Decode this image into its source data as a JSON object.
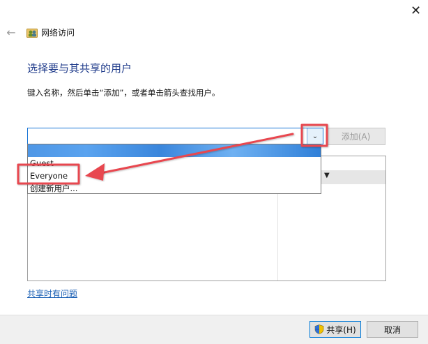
{
  "window": {
    "title": "网络访问",
    "close_glyph": "✕",
    "back_glyph": "←"
  },
  "heading": "选择要与其共享的用户",
  "instruction": "键入名称，然后单击“添加”，或者单击箭头查找用户。",
  "combo": {
    "value": "",
    "arrow_glyph": "⌄"
  },
  "add_button": "添加(A)",
  "dropdown": {
    "items": [
      "Guest",
      "Everyone",
      "创建新用户..."
    ]
  },
  "link": "共享时有问题",
  "footer": {
    "share": "共享(H)",
    "cancel": "取消"
  },
  "colors": {
    "accent": "#0078d7",
    "annotation": "#e8474f",
    "link": "#1a5fb4"
  }
}
